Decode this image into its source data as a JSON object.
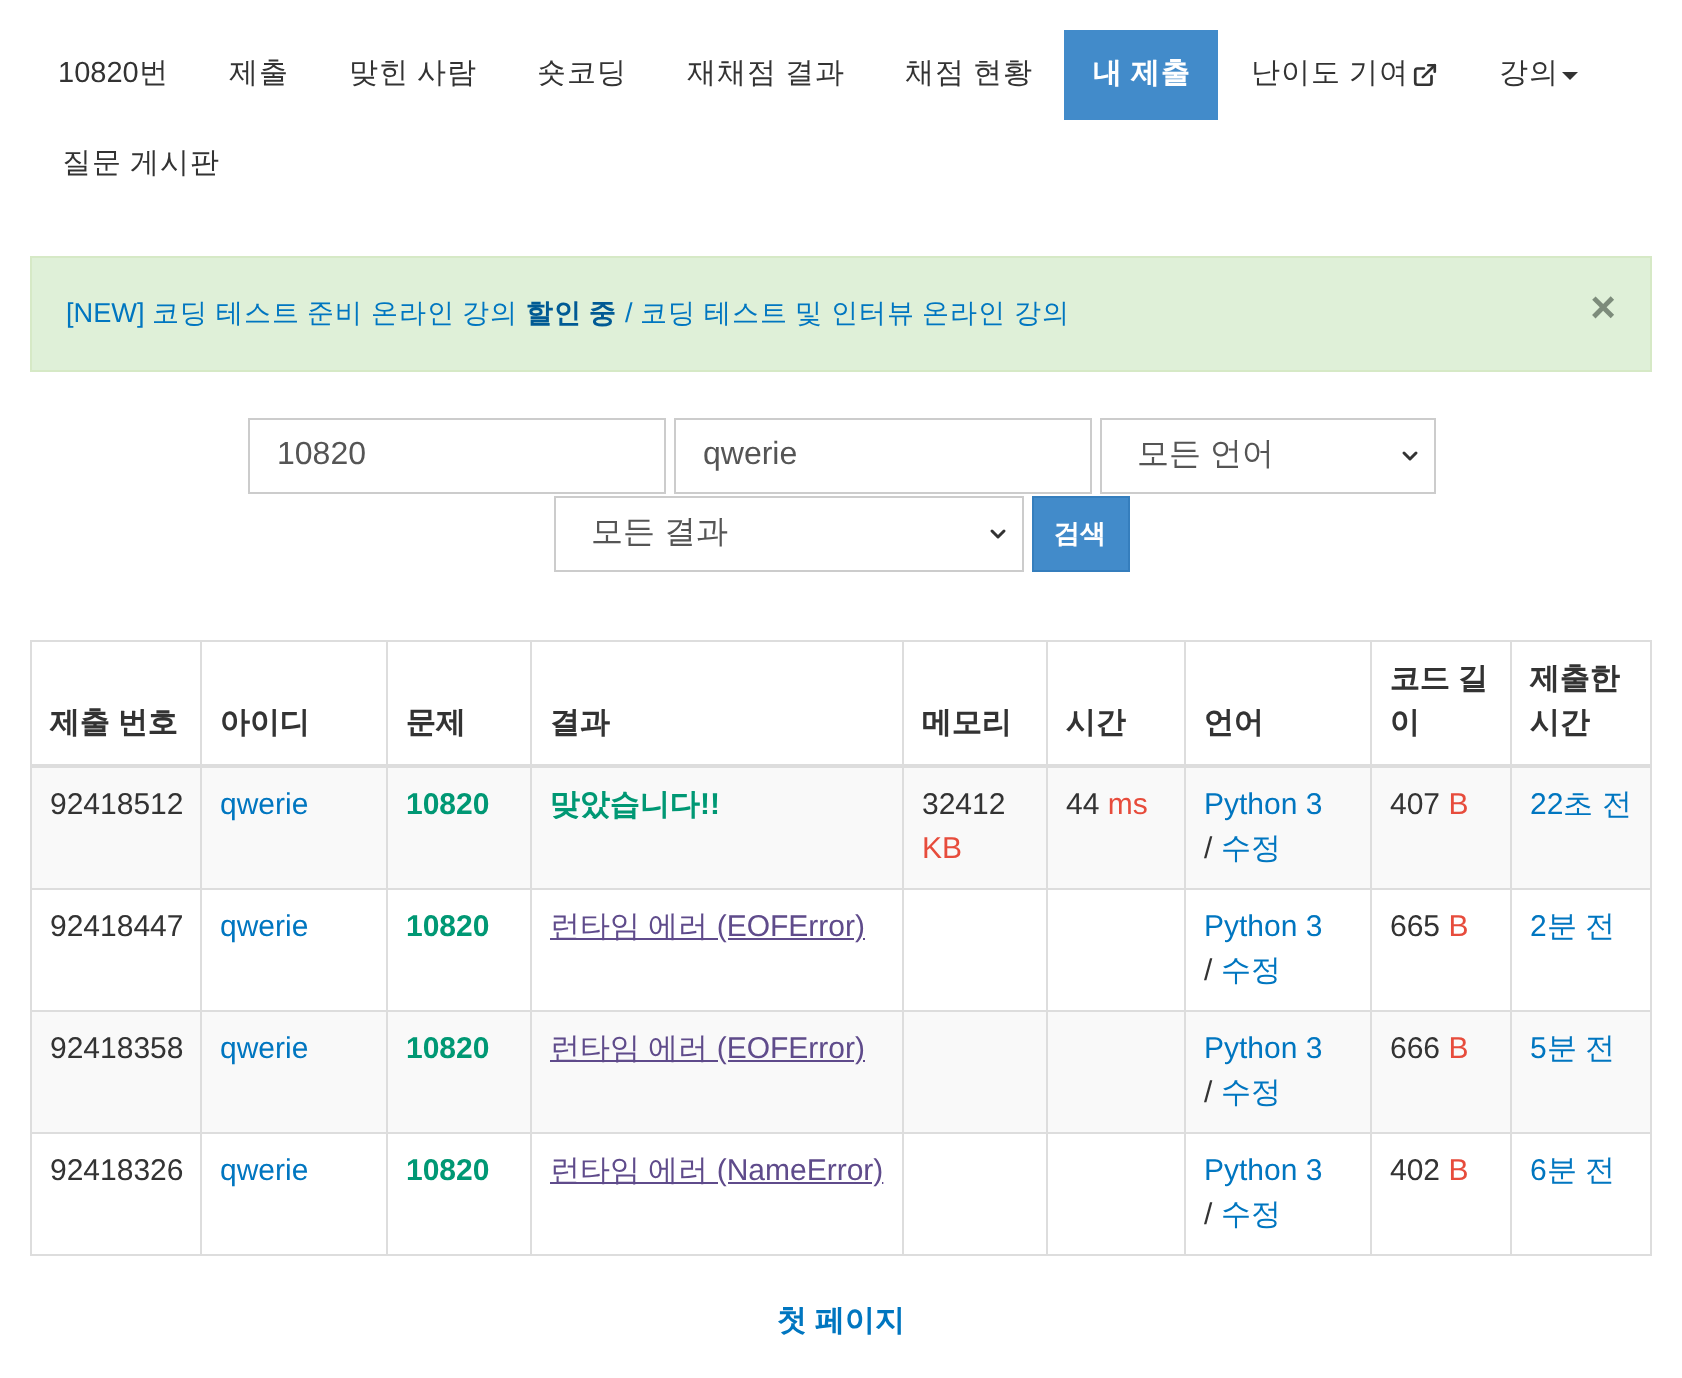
{
  "nav": {
    "tabs": [
      {
        "label": "10820번",
        "kind": "plain",
        "selected": false
      },
      {
        "label": "제출",
        "kind": "plain",
        "selected": false
      },
      {
        "label": "맞힌 사람",
        "kind": "plain",
        "selected": false
      },
      {
        "label": "숏코딩",
        "kind": "plain",
        "selected": false
      },
      {
        "label": "재채점 결과",
        "kind": "plain",
        "selected": false
      },
      {
        "label": "채점 현황",
        "kind": "plain",
        "selected": false
      },
      {
        "label": "내 제출",
        "kind": "plain",
        "selected": true
      },
      {
        "label": "난이도 기여",
        "kind": "external",
        "selected": false
      },
      {
        "label": "강의",
        "kind": "dropdown",
        "selected": false
      },
      {
        "label": "질문 게시판",
        "kind": "plain",
        "selected": false
      }
    ]
  },
  "alert": {
    "text": "[NEW] 코딩 테스트 준비 온라인 강의 **할인 중** / 코딩 테스트 및 인터뷰 온라인 강의",
    "close": "×"
  },
  "search": {
    "problem_id": "10820",
    "user_id": "qwerie",
    "language": "모든 언어",
    "result": "모든 결과",
    "button": "검색"
  },
  "table": {
    "columns": [
      "제출 번호",
      "아이디",
      "문제",
      "결과",
      "메모리",
      "시간",
      "언어",
      "코드 길이",
      "제출한 시간"
    ],
    "rows": [
      {
        "submission_id": "92418512",
        "user": "qwerie",
        "problem": "10820",
        "result": {
          "label": "맞았습니다!!",
          "kind": "accepted"
        },
        "memory": "32412",
        "memory_unit": "KB",
        "time": "44",
        "time_unit": "ms",
        "language": "Python 3",
        "separator": "/",
        "edit": "수정",
        "code_length": "407",
        "code_length_unit": "B",
        "submitted": "22초 전"
      },
      {
        "submission_id": "92418447",
        "user": "qwerie",
        "problem": "10820",
        "result": {
          "label": "런타임 에러 (EOFError)",
          "kind": "runtime_error"
        },
        "language": "Python 3",
        "separator": "/",
        "edit": "수정",
        "code_length": "665",
        "code_length_unit": "B",
        "submitted": "2분 전"
      },
      {
        "submission_id": "92418358",
        "user": "qwerie",
        "problem": "10820",
        "result": {
          "label": "런타임 에러 (EOFError)",
          "kind": "runtime_error"
        },
        "language": "Python 3",
        "separator": "/",
        "edit": "수정",
        "code_length": "666",
        "code_length_unit": "B",
        "submitted": "5분 전"
      },
      {
        "submission_id": "92418326",
        "user": "qwerie",
        "problem": "10820",
        "result": {
          "label": "런타임 에러 (NameError)",
          "kind": "runtime_error"
        },
        "language": "Python 3",
        "separator": "/",
        "edit": "수정",
        "code_length": "402",
        "code_length_unit": "B",
        "submitted": "6분 전"
      }
    ]
  },
  "pagination": {
    "first": "첫 페이지"
  }
}
